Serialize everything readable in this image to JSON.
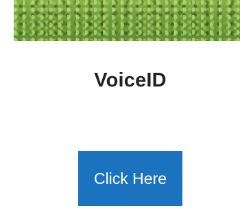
{
  "banner": {
    "image": "green-grass-texture"
  },
  "title": "VoiceID",
  "cta": {
    "label": "Click Here",
    "color": "#1b73bf"
  }
}
